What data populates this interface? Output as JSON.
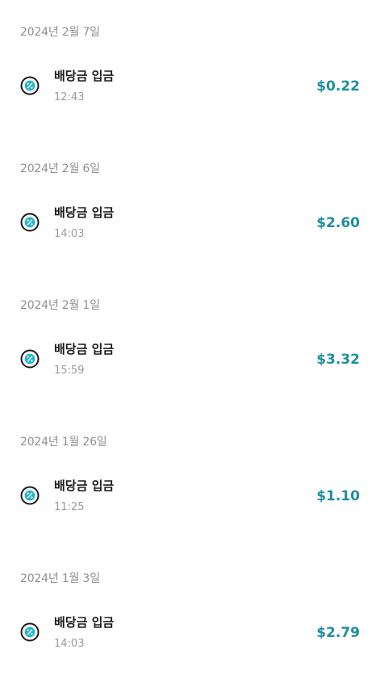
{
  "transactions": [
    {
      "date": "2024년 2월 7일",
      "title": "배당금 입금",
      "time": "12:43",
      "amount": "$0.22",
      "icon": "percent-icon"
    },
    {
      "date": "2024년 2월 6일",
      "title": "배당금 입금",
      "time": "14:03",
      "amount": "$2.60",
      "icon": "percent-icon"
    },
    {
      "date": "2024년 2월 1일",
      "title": "배당금 입금",
      "time": "15:59",
      "amount": "$3.32",
      "icon": "percent-icon"
    },
    {
      "date": "2024년 1월 26일",
      "title": "배당금 입금",
      "time": "11:25",
      "amount": "$1.10",
      "icon": "percent-icon"
    },
    {
      "date": "2024년 1월 3일",
      "title": "배당금 입금",
      "time": "14:03",
      "amount": "$2.79",
      "icon": "percent-icon"
    }
  ],
  "colors": {
    "amount": "#1f8fa0",
    "icon_badge": "#29b6c6",
    "date_text": "#8f8f8f"
  }
}
